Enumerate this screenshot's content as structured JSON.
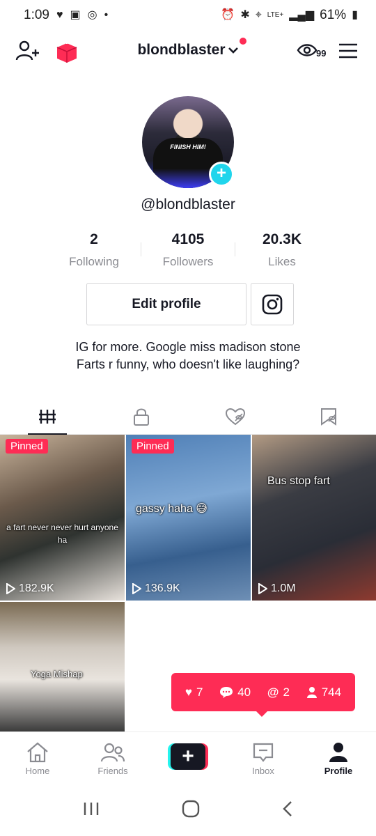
{
  "status_bar": {
    "time": "1:09",
    "battery": "61%",
    "network": "LTE+"
  },
  "header": {
    "username": "blondblaster",
    "profile_views_count": "99"
  },
  "profile": {
    "handle": "@blondblaster",
    "avatar_shirt_text": "FINISH HIM!",
    "stats": [
      {
        "value": "2",
        "label": "Following"
      },
      {
        "value": "4105",
        "label": "Followers"
      },
      {
        "value": "20.3K",
        "label": "Likes"
      }
    ],
    "edit_profile_label": "Edit profile",
    "bio_line1": "IG for more. Google miss madison stone",
    "bio_line2": "Farts r funny, who doesn't like laughing?"
  },
  "videos": [
    {
      "pinned_label": "Pinned",
      "caption": "a fart never never hurt anyone ha",
      "views": "182.9K"
    },
    {
      "pinned_label": "Pinned",
      "caption": "gassy haha 😅",
      "views": "136.9K"
    },
    {
      "caption": "Bus stop fart",
      "views": "1.0M"
    },
    {
      "caption": "Yoga Mishap"
    }
  ],
  "notifications": {
    "likes": "7",
    "comments": "40",
    "mentions": "2",
    "followers": "744"
  },
  "bottom_nav": {
    "home": "Home",
    "friends": "Friends",
    "inbox": "Inbox",
    "profile": "Profile"
  },
  "colors": {
    "accent": "#fe2c55",
    "cyan": "#20d5ec"
  }
}
